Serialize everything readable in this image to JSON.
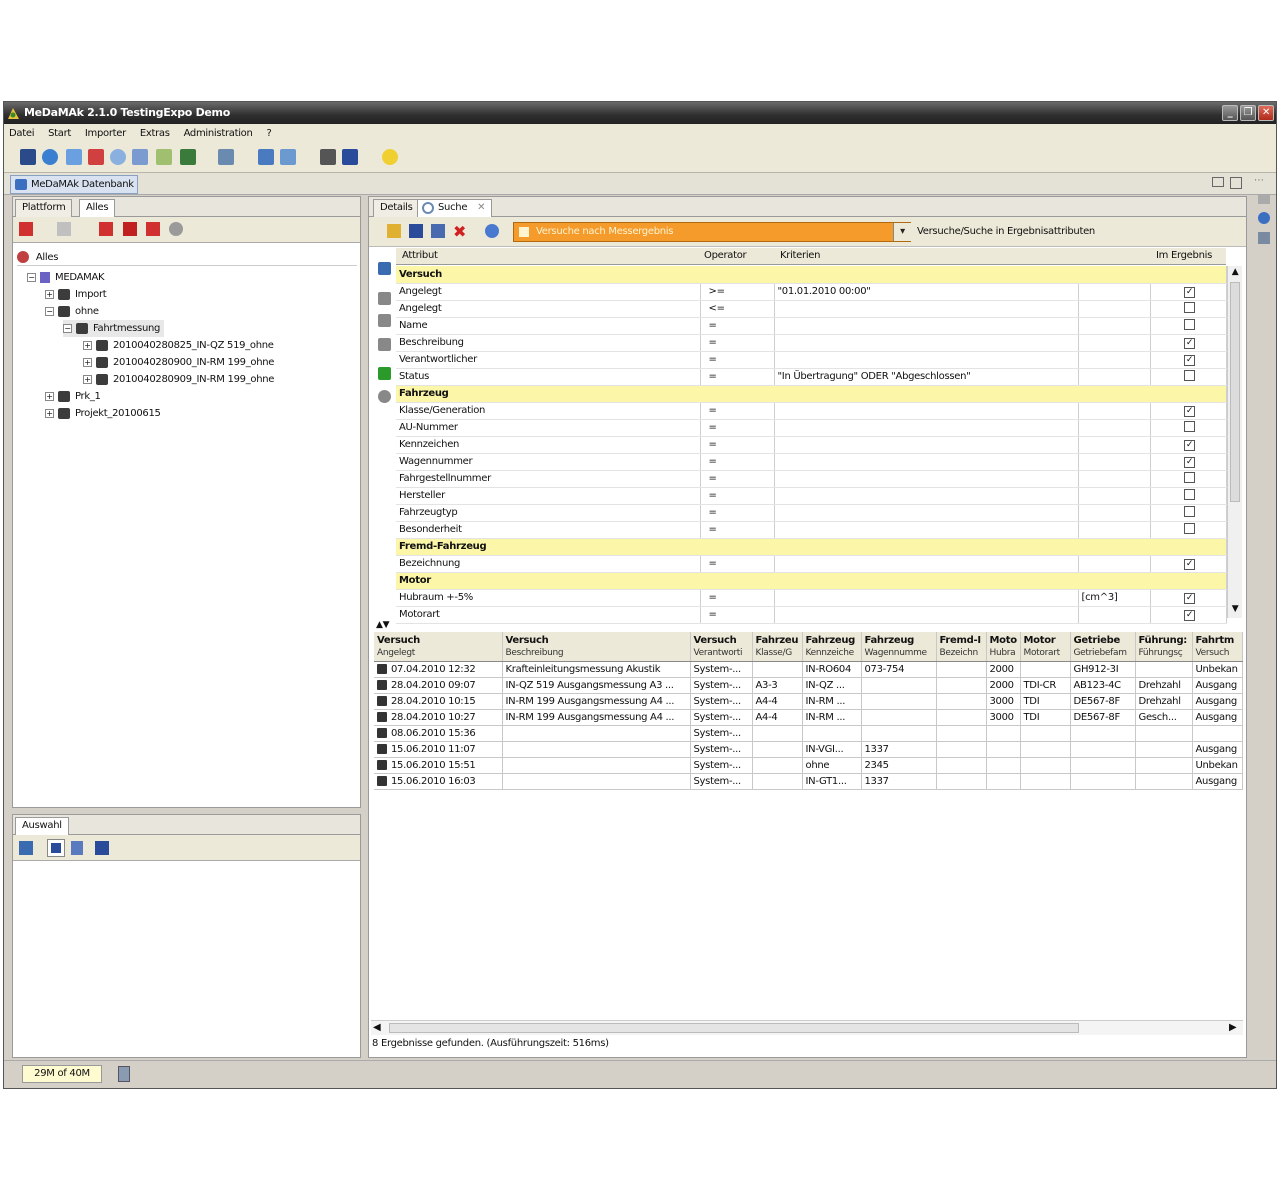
{
  "window": {
    "title": "MeDaMAk 2.1.0 TestingExpo Demo"
  },
  "menu": [
    "Datei",
    "Start",
    "Importer",
    "Extras",
    "Administration",
    "?"
  ],
  "perspective_tab": "MeDaMAk Datenbank",
  "left_panel": {
    "tabs": [
      "Plattform",
      "Alles"
    ],
    "tree": [
      {
        "label": "Alles"
      },
      {
        "label": "MEDAMAK"
      },
      {
        "label": "Import"
      },
      {
        "label": "ohne"
      },
      {
        "label": "Fahrtmessung"
      },
      {
        "label": "2010040280825_IN-QZ 519_ohne"
      },
      {
        "label": "2010040280900_IN-RM 199_ohne"
      },
      {
        "label": "2010040280909_IN-RM 199_ohne"
      },
      {
        "label": "Prk_1"
      },
      {
        "label": "Projekt_20100615"
      }
    ]
  },
  "selection_panel": {
    "tab": "Auswahl"
  },
  "editor": {
    "tabs": [
      "Details",
      "Suche"
    ],
    "query_name": "Versuche nach Messergebnis",
    "query_option": "Versuche/Suche in Ergebnisattributen",
    "grid_headers": [
      "Attribut",
      "Operator",
      "Kriterien",
      "",
      "Im Ergebnis"
    ],
    "grid_rows": [
      {
        "section": "Versuch"
      },
      {
        "attr": "Angelegt",
        "op": ">=",
        "crit": "\"01.01.2010 00:00\"",
        "unit": "",
        "checked": true
      },
      {
        "attr": "Angelegt",
        "op": "<=",
        "crit": "",
        "unit": "",
        "checked": false
      },
      {
        "attr": "Name",
        "op": "=",
        "crit": "",
        "unit": "",
        "checked": false
      },
      {
        "attr": "Beschreibung",
        "op": "=",
        "crit": "",
        "unit": "",
        "checked": true
      },
      {
        "attr": "Verantwortlicher",
        "op": "=",
        "crit": "",
        "unit": "",
        "checked": true
      },
      {
        "attr": "Status",
        "op": "=",
        "crit": "\"In Übertragung\" ODER \"Abgeschlossen\"",
        "unit": "",
        "checked": false
      },
      {
        "section": "Fahrzeug"
      },
      {
        "attr": "Klasse/Generation",
        "op": "=",
        "crit": "",
        "unit": "",
        "checked": true
      },
      {
        "attr": "AU-Nummer",
        "op": "=",
        "crit": "",
        "unit": "",
        "checked": false
      },
      {
        "attr": "Kennzeichen",
        "op": "=",
        "crit": "",
        "unit": "",
        "checked": true
      },
      {
        "attr": "Wagennummer",
        "op": "=",
        "crit": "",
        "unit": "",
        "checked": true
      },
      {
        "attr": "Fahrgestellnummer",
        "op": "=",
        "crit": "",
        "unit": "",
        "checked": false
      },
      {
        "attr": "Hersteller",
        "op": "=",
        "crit": "",
        "unit": "",
        "checked": false
      },
      {
        "attr": "Fahrzeugtyp",
        "op": "=",
        "crit": "",
        "unit": "",
        "checked": false
      },
      {
        "attr": "Besonderheit",
        "op": "=",
        "crit": "",
        "unit": "",
        "checked": false
      },
      {
        "section": "Fremd-Fahrzeug"
      },
      {
        "attr": "Bezeichnung",
        "op": "=",
        "crit": "",
        "unit": "",
        "checked": true
      },
      {
        "section": "Motor"
      },
      {
        "attr": "Hubraum +-5%",
        "op": "=",
        "crit": "",
        "unit": "[cm^3]",
        "checked": true
      },
      {
        "attr": "Motorart",
        "op": "=",
        "crit": "",
        "unit": "",
        "checked": true
      }
    ]
  },
  "results": {
    "headers": [
      [
        "Versuch",
        "Angelegt"
      ],
      [
        "Versuch",
        "Beschreibung"
      ],
      [
        "Versuch",
        "Verantworti"
      ],
      [
        "Fahrzeu",
        "Klasse/G"
      ],
      [
        "Fahrzeug",
        "Kennzeiche"
      ],
      [
        "Fahrzeug",
        "Wagennumme"
      ],
      [
        "Fremd-I",
        "Bezeichn"
      ],
      [
        "Moto",
        "Hubra"
      ],
      [
        "Motor",
        "Motorart"
      ],
      [
        "Getriebe",
        "Getriebefam"
      ],
      [
        "Führung:",
        "Führungsç"
      ],
      [
        "Fahrtm",
        "Versuch"
      ]
    ],
    "rows": [
      [
        "07.04.2010 12:32",
        "Krafteinleitungsmessung Akustik",
        "System-...",
        "",
        "IN-RO604",
        "073-754",
        "",
        "2000",
        "",
        "GH912-3I",
        "",
        "Unbekan"
      ],
      [
        "28.04.2010 09:07",
        "IN-QZ 519 Ausgangsmessung A3 ...",
        "System-...",
        "A3-3",
        "IN-QZ ...",
        "",
        "",
        "2000",
        "TDI-CR",
        "AB123-4C",
        "Drehzahl",
        "Ausgang"
      ],
      [
        "28.04.2010 10:15",
        "IN-RM 199 Ausgangsmessung A4 ...",
        "System-...",
        "A4-4",
        "IN-RM ...",
        "",
        "",
        "3000",
        "TDI",
        "DE567-8F",
        "Drehzahl",
        "Ausgang"
      ],
      [
        "28.04.2010 10:27",
        "IN-RM 199 Ausgangsmessung A4 ...",
        "System-...",
        "A4-4",
        "IN-RM ...",
        "",
        "",
        "3000",
        "TDI",
        "DE567-8F",
        "Gesch...",
        "Ausgang"
      ],
      [
        "08.06.2010 15:36",
        "",
        "System-...",
        "",
        "",
        "",
        "",
        "",
        "",
        "",
        "",
        ""
      ],
      [
        "15.06.2010 11:07",
        "",
        "System-...",
        "",
        "IN-VGI...",
        "1337",
        "",
        "",
        "",
        "",
        "",
        "Ausgang"
      ],
      [
        "15.06.2010 15:51",
        "",
        "System-...",
        "",
        "ohne",
        "2345",
        "",
        "",
        "",
        "",
        "",
        "Unbekan"
      ],
      [
        "15.06.2010 16:03",
        "",
        "System-...",
        "",
        "IN-GT1...",
        "1337",
        "",
        "",
        "",
        "",
        "",
        "Ausgang"
      ]
    ],
    "status": "8 Ergebnisse gefunden. (Ausführungszeit: 516ms)"
  },
  "statusbar": {
    "memory": "29M of 40M"
  },
  "colors": {
    "section_bg": "#fbf6a8",
    "query_combo": "#f49b2b",
    "title_bar": "#2f2f2f"
  }
}
